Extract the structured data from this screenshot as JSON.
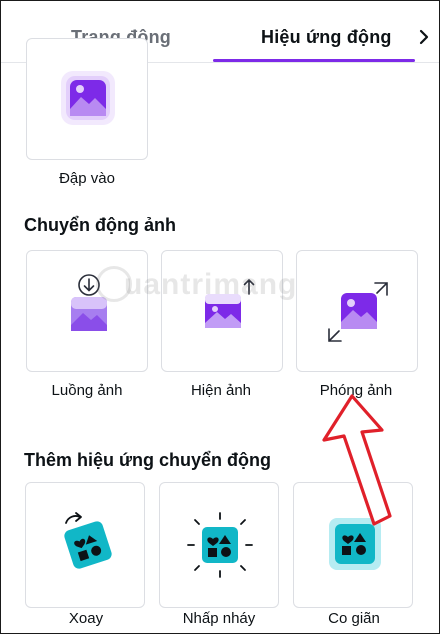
{
  "tabs": [
    {
      "label": "Trang động",
      "active": false
    },
    {
      "label": "Hiệu ứng động",
      "active": true
    }
  ],
  "accent_color": "#7d2ae8",
  "top_tile": {
    "label": "Đập vào"
  },
  "section_photo": {
    "title": "Chuyển động ảnh",
    "items": [
      {
        "label": "Luồng ảnh"
      },
      {
        "label": "Hiện ảnh"
      },
      {
        "label": "Phóng ảnh"
      }
    ]
  },
  "section_motion": {
    "title": "Thêm hiệu ứng chuyển động",
    "items": [
      {
        "label": "Xoay"
      },
      {
        "label": "Nhấp nháy"
      },
      {
        "label": "Co giãn"
      }
    ]
  },
  "watermark_text": "uantrimang",
  "icons": [
    "chevron-right-icon",
    "image-icon",
    "arrow-down-icon",
    "arrow-up-icon",
    "expand-arrows-icon",
    "rotate-icon",
    "shapes-icon",
    "red-arrow-annotation"
  ]
}
